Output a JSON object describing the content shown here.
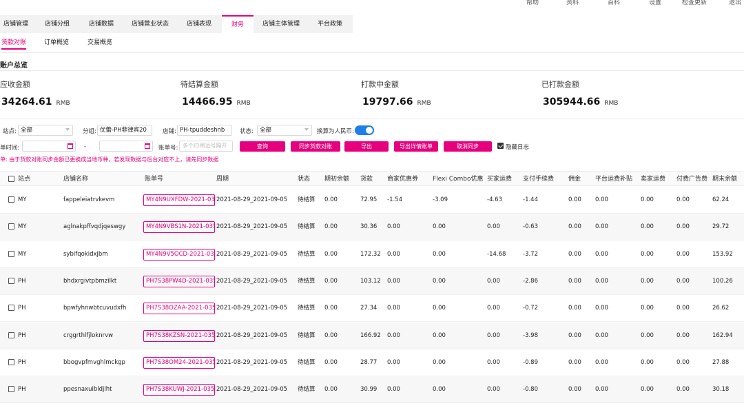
{
  "top_menu": [
    "帮助",
    "资料",
    "百科",
    "设置",
    "检查更新",
    "退出"
  ],
  "main_tabs": [
    "店铺管理",
    "店铺分组",
    "店铺数据",
    "店铺营业状态",
    "店铺表现",
    "财务",
    "店铺主体管理",
    "平台政策"
  ],
  "sub_tabs": [
    "货款对账",
    "订单概览",
    "交易概览"
  ],
  "summary": {
    "title": "账户总览",
    "cards": [
      {
        "label": "应收金额",
        "value": "34264.61",
        "unit": "RMB"
      },
      {
        "label": "待结算金额",
        "value": "14466.95",
        "unit": "RMB"
      },
      {
        "label": "打款中金额",
        "value": "19797.66",
        "unit": "RMB"
      },
      {
        "label": "已打款金额",
        "value": "305944.66",
        "unit": "RMB"
      }
    ]
  },
  "filters": {
    "site_label": "站点:",
    "site_value": "全部",
    "group_label": "分组:",
    "group_value": "优蕾-PH菲律宾20",
    "shop_label": "店铺:",
    "shop_value": "PH-tpuddeshnb",
    "status_label": "状态:",
    "status_value": "全部",
    "rmb_label": "换算为人民币:",
    "time_label": "单时间:",
    "date_sep": "-",
    "bill_label": "账单号:",
    "bill_placeholder": "多个ID用逗号隔开",
    "hide_log_label": "隐藏日志"
  },
  "buttons": [
    "查询",
    "同步货款对账",
    "导出",
    "导出详情账单",
    "取消同步"
  ],
  "notice": "单: 由于货款对账同步金额已更换成当地币种，若发现数据与后台对应不上，请先同步数据",
  "table": {
    "headers": [
      "站点",
      "店铺名称",
      "账单号",
      "周期",
      "状态",
      "期初余额",
      "货款",
      "商家优惠券",
      "Flexi Combo优惠",
      "买家运费",
      "支付手续费",
      "佣金",
      "平台运费补贴",
      "卖家运费",
      "付费广告费",
      "期末余额"
    ],
    "rows": [
      [
        "MY",
        "fappeleiatrvkevm",
        "MY4N9UXFDW-2021-035",
        "2021-08-29_2021-09-05",
        "待结算",
        "0.00",
        "72.95",
        "-1.54",
        "-3.09",
        "-4.63",
        "-1.44",
        "0.00",
        "0.00",
        "0.00",
        "0.00",
        "62.24"
      ],
      [
        "MY",
        "aglnakpffvqdjqeswgy",
        "MY4N9VBS1N-2021-035",
        "2021-08-29_2021-09-05",
        "待结算",
        "0.00",
        "30.36",
        "0.00",
        "0.00",
        "0.00",
        "-0.63",
        "0.00",
        "0.00",
        "0.00",
        "0.00",
        "29.72"
      ],
      [
        "MY",
        "sybifqokidxjbm",
        "MY4N9V5OCD-2021-035",
        "2021-08-29_2021-09-05",
        "待结算",
        "0.00",
        "172.32",
        "0.00",
        "0.00",
        "-14.68",
        "-3.72",
        "0.00",
        "0.00",
        "0.00",
        "0.00",
        "153.92"
      ],
      [
        "PH",
        "bhdxrgivtpbmzilkt",
        "PH7S38PW4D-2021-035",
        "2021-08-29_2021-09-05",
        "待结算",
        "0.00",
        "103.12",
        "0.00",
        "0.00",
        "0.00",
        "-2.86",
        "0.00",
        "0.00",
        "0.00",
        "0.00",
        "100.26"
      ],
      [
        "PH",
        "bpwfyhnwbtcuvudxfh",
        "PH7S38OZAA-2021-035",
        "2021-08-29_2021-09-05",
        "待结算",
        "0.00",
        "27.34",
        "0.00",
        "0.00",
        "0.00",
        "-0.72",
        "0.00",
        "0.00",
        "0.00",
        "0.00",
        "26.62"
      ],
      [
        "PH",
        "crggrthlfjloknrvw",
        "PH7S38KZSN-2021-035",
        "2021-08-29_2021-09-05",
        "待结算",
        "0.00",
        "166.92",
        "0.00",
        "0.00",
        "0.00",
        "-3.98",
        "0.00",
        "0.00",
        "0.00",
        "0.00",
        "162.94"
      ],
      [
        "PH",
        "bbogvpfmvghlmckgp",
        "PH7S38OM24-2021-035",
        "2021-08-29_2021-09-05",
        "待结算",
        "0.00",
        "28.77",
        "0.00",
        "0.00",
        "0.00",
        "-0.89",
        "0.00",
        "0.00",
        "0.00",
        "0.00",
        "27.88"
      ],
      [
        "PH",
        "ppesnaxuibldjlht",
        "PH7S38KUWJ-2021-035",
        "2021-08-29_2021-09-05",
        "待结算",
        "0.00",
        "30.99",
        "0.00",
        "0.00",
        "0.00",
        "-0.80",
        "0.00",
        "0.00",
        "0.00",
        "0.00",
        "30.18"
      ]
    ]
  },
  "colors": {
    "accent": "#e6007e",
    "toggle": "#1e7fe8"
  }
}
